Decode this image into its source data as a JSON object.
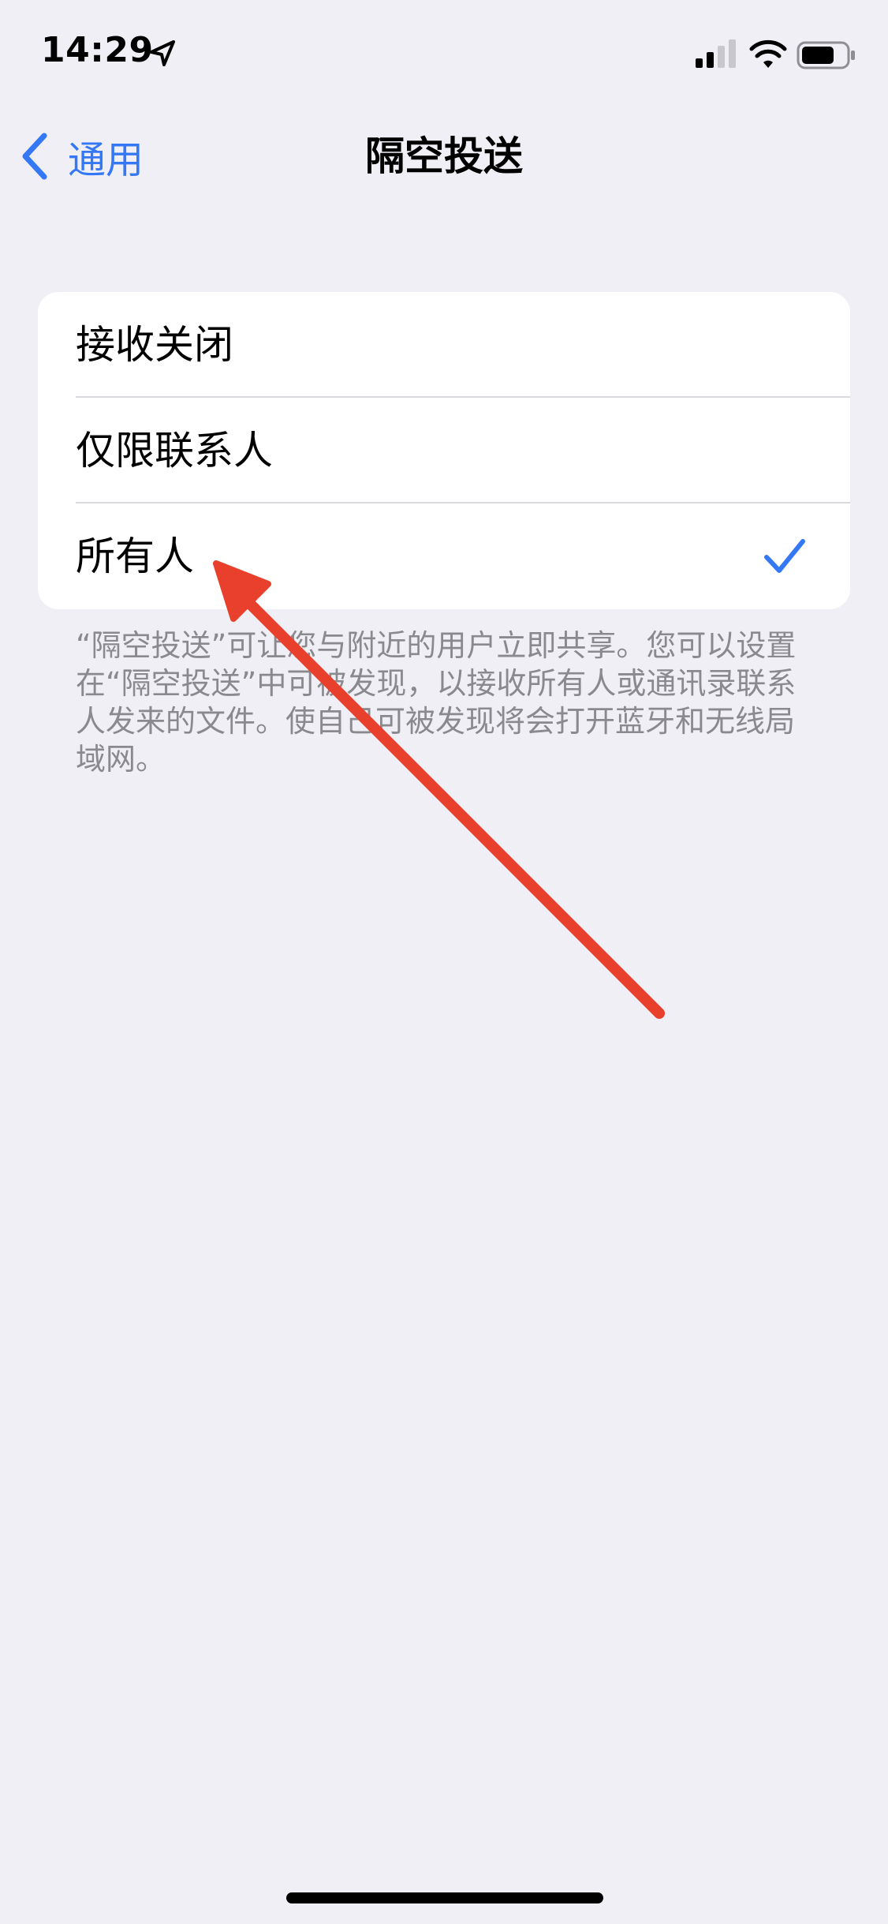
{
  "status_bar": {
    "time": "14:29",
    "icons": [
      "location-arrow-icon",
      "cellular-signal-icon",
      "wifi-icon",
      "battery-icon"
    ]
  },
  "nav": {
    "back_label": "通用",
    "title": "隔空投送"
  },
  "options": [
    {
      "label": "接收关闭",
      "selected": false
    },
    {
      "label": "仅限联系人",
      "selected": false
    },
    {
      "label": "所有人",
      "selected": true
    }
  ],
  "footer_text": "“隔空投送”可让您与附近的用户立即共享。您可以设置在“隔空投送”中可被发现，以接收所有人或通讯录联系人发来的文件。使自己可被发现将会打开蓝牙和无线局域网。",
  "colors": {
    "accent": "#3478f6",
    "background": "#f0eff5",
    "annotation": "#e8402c"
  }
}
